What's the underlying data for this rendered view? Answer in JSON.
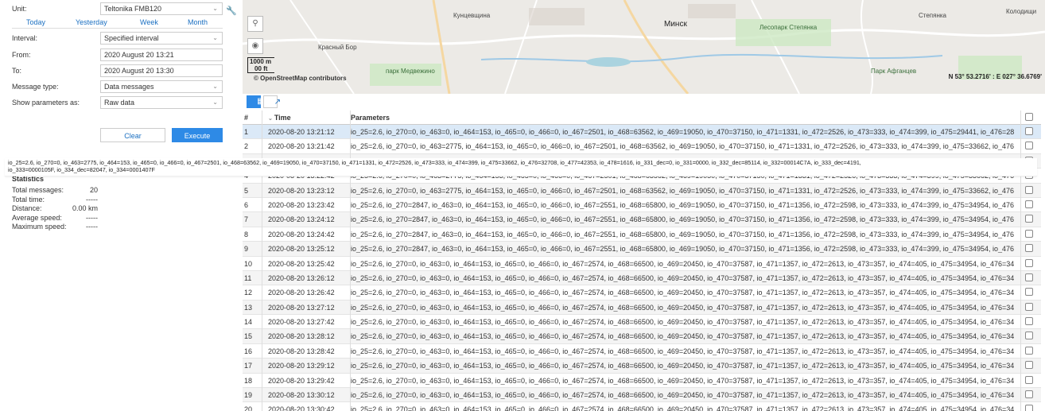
{
  "form": {
    "unit_label": "Unit:",
    "unit_value": "Teltonika FMB120",
    "quick": [
      "Today",
      "Yesterday",
      "Week",
      "Month"
    ],
    "interval_label": "Interval:",
    "interval_value": "Specified interval",
    "from_label": "From:",
    "from_value": "2020 August 20 13:21",
    "to_label": "To:",
    "to_value": "2020 August 20 13:30",
    "msgtype_label": "Message type:",
    "msgtype_value": "Data messages",
    "showparams_label": "Show parameters as:",
    "showparams_value": "Raw data",
    "clear_label": "Clear",
    "execute_label": "Execute"
  },
  "stats": {
    "title": "Statistics",
    "rows": [
      {
        "k": "Total messages:",
        "v": "20"
      },
      {
        "k": "Total time:",
        "v": "-----"
      },
      {
        "k": "Distance:",
        "v": "0.00 km"
      },
      {
        "k": "Average speed:",
        "v": "-----"
      },
      {
        "k": "Maximum speed:",
        "v": "-----"
      }
    ]
  },
  "tooltip": {
    "line1": "io_25=2.6, io_270=0, io_463=2775, io_464=153, io_465=0, io_466=0, io_467=2501, io_468=63562, io_469=19050, io_470=37150, io_471=1331, io_472=2526, io_473=333, io_474=399, io_475=33662, io_476=32708, io_477=42353, io_478=1616, io_331_dec=0, io_331=0000, io_332_dec=85114, io_332=00014C7A, io_333_dec=4191,",
    "line2": "io_333=0000105F, io_334_dec=82047, io_334=0001407F"
  },
  "map": {
    "city_minsk": "Минск",
    "city_kunashi": "Кунцевщина",
    "park_stepyanka": "Лесопарк Степянка",
    "park_medvezhino": "парк Медвежино",
    "park_afgantsev": "Парк Афганцев",
    "district_krasny_bor": "Красный Бор",
    "stepyanka": "Степянка",
    "kolodishchi": "Колодищи",
    "scale_km": "1000 m",
    "scale_ft": "00 ft",
    "attribution": "© OpenStreetMap contributors",
    "coordinates": "N 53° 53.2716' : E 027° 36.6769'"
  },
  "table": {
    "headers": {
      "num": "#",
      "time": "Time",
      "params": "Parameters"
    },
    "rows": [
      {
        "n": "1",
        "t": "2020-08-20 13:21:12",
        "p": "io_25=2.6, io_270=0, io_463=0, io_464=153, io_465=0, io_466=0, io_467=2501, io_468=63562, io_469=19050, io_470=37150, io_471=1331, io_472=2526, io_473=333, io_474=399, io_475=29441, io_476=28"
      },
      {
        "n": "2",
        "t": "2020-08-20 13:21:42",
        "p": "io_25=2.6, io_270=0, io_463=2775, io_464=153, io_465=0, io_466=0, io_467=2501, io_468=63562, io_469=19050, io_470=37150, io_471=1331, io_472=2526, io_473=333, io_474=399, io_475=33662, io_476"
      },
      {
        "n": "3",
        "t": "2020-08-20 13:22:12",
        "p": "io_25=2.6, io_270=0, io_463=2775, io_464=153, io_465=0, io_466=0, io_467=2501, io_468=63562, io_469=19050, io_470=37150, io_471=1331, io_472=2526, io_473=333, io_474=399, io_475=33662, io_476"
      },
      {
        "n": "4",
        "t": "2020-08-20 13:22:42",
        "p": "io_25=2.6, io_270=0, io_463=2775, io_464=153, io_465=0, io_466=0, io_467=2501, io_468=63562, io_469=19050, io_470=37150, io_471=1331, io_472=2526, io_473=333, io_474=399, io_475=33662, io_476"
      },
      {
        "n": "5",
        "t": "2020-08-20 13:23:12",
        "p": "io_25=2.6, io_270=0, io_463=2775, io_464=153, io_465=0, io_466=0, io_467=2501, io_468=63562, io_469=19050, io_470=37150, io_471=1331, io_472=2526, io_473=333, io_474=399, io_475=33662, io_476"
      },
      {
        "n": "6",
        "t": "2020-08-20 13:23:42",
        "p": "io_25=2.6, io_270=2847, io_463=0, io_464=153, io_465=0, io_466=0, io_467=2551, io_468=65800, io_469=19050, io_470=37150, io_471=1356, io_472=2598, io_473=333, io_474=399, io_475=34954, io_476"
      },
      {
        "n": "7",
        "t": "2020-08-20 13:24:12",
        "p": "io_25=2.6, io_270=2847, io_463=0, io_464=153, io_465=0, io_466=0, io_467=2551, io_468=65800, io_469=19050, io_470=37150, io_471=1356, io_472=2598, io_473=333, io_474=399, io_475=34954, io_476"
      },
      {
        "n": "8",
        "t": "2020-08-20 13:24:42",
        "p": "io_25=2.6, io_270=2847, io_463=0, io_464=153, io_465=0, io_466=0, io_467=2551, io_468=65800, io_469=19050, io_470=37150, io_471=1356, io_472=2598, io_473=333, io_474=399, io_475=34954, io_476"
      },
      {
        "n": "9",
        "t": "2020-08-20 13:25:12",
        "p": "io_25=2.6, io_270=2847, io_463=0, io_464=153, io_465=0, io_466=0, io_467=2551, io_468=65800, io_469=19050, io_470=37150, io_471=1356, io_472=2598, io_473=333, io_474=399, io_475=34954, io_476"
      },
      {
        "n": "10",
        "t": "2020-08-20 13:25:42",
        "p": "io_25=2.6, io_270=0, io_463=0, io_464=153, io_465=0, io_466=0, io_467=2574, io_468=66500, io_469=20450, io_470=37587, io_471=1357, io_472=2613, io_473=357, io_474=405, io_475=34954, io_476=34"
      },
      {
        "n": "11",
        "t": "2020-08-20 13:26:12",
        "p": "io_25=2.6, io_270=0, io_463=0, io_464=153, io_465=0, io_466=0, io_467=2574, io_468=66500, io_469=20450, io_470=37587, io_471=1357, io_472=2613, io_473=357, io_474=405, io_475=34954, io_476=34"
      },
      {
        "n": "12",
        "t": "2020-08-20 13:26:42",
        "p": "io_25=2.6, io_270=0, io_463=0, io_464=153, io_465=0, io_466=0, io_467=2574, io_468=66500, io_469=20450, io_470=37587, io_471=1357, io_472=2613, io_473=357, io_474=405, io_475=34954, io_476=34"
      },
      {
        "n": "13",
        "t": "2020-08-20 13:27:12",
        "p": "io_25=2.6, io_270=0, io_463=0, io_464=153, io_465=0, io_466=0, io_467=2574, io_468=66500, io_469=20450, io_470=37587, io_471=1357, io_472=2613, io_473=357, io_474=405, io_475=34954, io_476=34"
      },
      {
        "n": "14",
        "t": "2020-08-20 13:27:42",
        "p": "io_25=2.6, io_270=0, io_463=0, io_464=153, io_465=0, io_466=0, io_467=2574, io_468=66500, io_469=20450, io_470=37587, io_471=1357, io_472=2613, io_473=357, io_474=405, io_475=34954, io_476=34"
      },
      {
        "n": "15",
        "t": "2020-08-20 13:28:12",
        "p": "io_25=2.6, io_270=0, io_463=0, io_464=153, io_465=0, io_466=0, io_467=2574, io_468=66500, io_469=20450, io_470=37587, io_471=1357, io_472=2613, io_473=357, io_474=405, io_475=34954, io_476=34"
      },
      {
        "n": "16",
        "t": "2020-08-20 13:28:42",
        "p": "io_25=2.6, io_270=0, io_463=0, io_464=153, io_465=0, io_466=0, io_467=2574, io_468=66500, io_469=20450, io_470=37587, io_471=1357, io_472=2613, io_473=357, io_474=405, io_475=34954, io_476=34"
      },
      {
        "n": "17",
        "t": "2020-08-20 13:29:12",
        "p": "io_25=2.6, io_270=0, io_463=0, io_464=153, io_465=0, io_466=0, io_467=2574, io_468=66500, io_469=20450, io_470=37587, io_471=1357, io_472=2613, io_473=357, io_474=405, io_475=34954, io_476=34"
      },
      {
        "n": "18",
        "t": "2020-08-20 13:29:42",
        "p": "io_25=2.6, io_270=0, io_463=0, io_464=153, io_465=0, io_466=0, io_467=2574, io_468=66500, io_469=20450, io_470=37587, io_471=1357, io_472=2613, io_473=357, io_474=405, io_475=34954, io_476=34"
      },
      {
        "n": "19",
        "t": "2020-08-20 13:30:12",
        "p": "io_25=2.6, io_270=0, io_463=0, io_464=153, io_465=0, io_466=0, io_467=2574, io_468=66500, io_469=20450, io_470=37587, io_471=1357, io_472=2613, io_473=357, io_474=405, io_475=34954, io_476=34"
      },
      {
        "n": "20",
        "t": "2020-08-20 13:30:42",
        "p": "io_25=2.6, io_270=0, io_463=0, io_464=153, io_465=0, io_466=0, io_467=2574, io_468=66500, io_469=20450, io_470=37587, io_471=1357, io_472=2613, io_473=357, io_474=405, io_475=34954, io_476=34"
      }
    ]
  },
  "icons": {
    "wrench": "wrench-icon",
    "search": "search-icon",
    "eye": "eye-icon",
    "grid": "grid-icon",
    "chart": "chart-icon",
    "sort": "sort-desc-icon",
    "caret": "chevron-down-icon"
  },
  "colors": {
    "accent": "#2e8ae6",
    "link": "#1a6fc1",
    "selected_row": "#dbe9f7"
  }
}
